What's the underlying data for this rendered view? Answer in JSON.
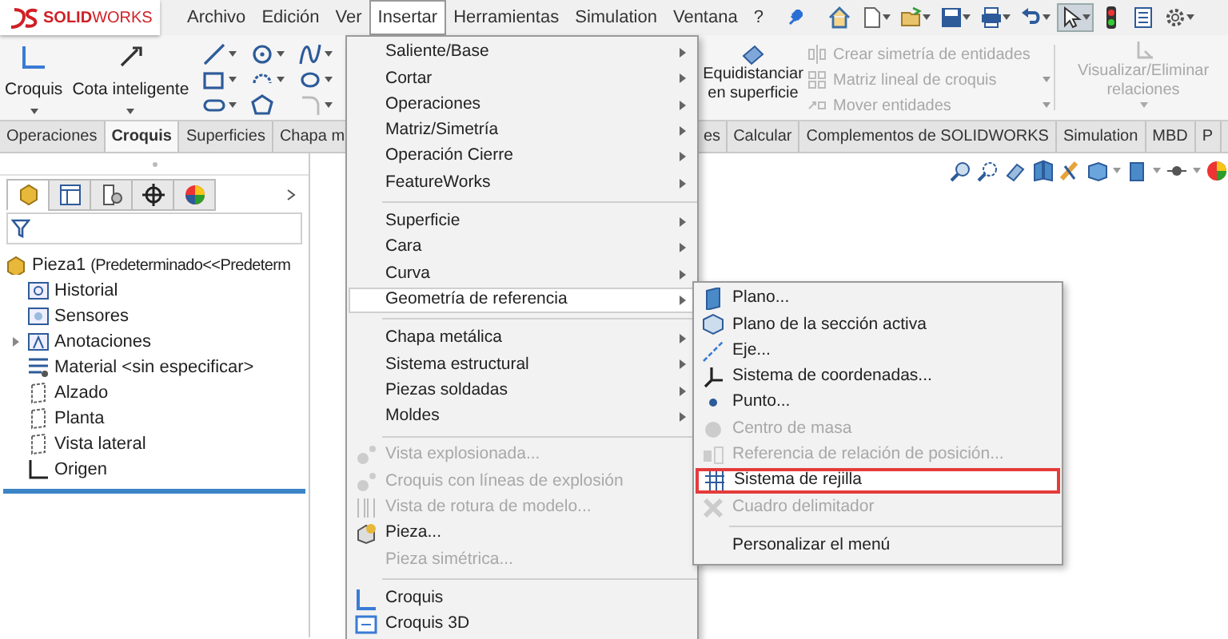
{
  "title_bar": {
    "logo_text": "**SOLID**WORKS"
  },
  "menu_bar": [
    {
      "label": "Archivo",
      "selected": false
    },
    {
      "label": "Edición",
      "selected": false
    },
    {
      "label": "Ver",
      "selected": false
    },
    {
      "label": "Insertar",
      "selected": true
    },
    {
      "label": "Herramientas",
      "selected": false
    },
    {
      "label": "Simulation",
      "selected": false
    },
    {
      "label": "Ventana",
      "selected": false
    },
    {
      "label": "?",
      "selected": false
    }
  ],
  "quick_access": {
    "select_tool": {
      "selected": true
    }
  },
  "ribbon": {
    "big_tools": [
      {
        "label": "Croquis"
      },
      {
        "label": "Cota inteligente"
      }
    ],
    "offset_tool": {
      "lines": [
        "Equidistanciar",
        "en superficie"
      ]
    },
    "commands": [
      {
        "label": "Crear simetría de entidades",
        "disabled": true,
        "dropdown": false
      },
      {
        "label": "Matriz lineal de croquis",
        "disabled": true,
        "dropdown": true
      },
      {
        "label": "Mover entidades",
        "disabled": true,
        "dropdown": true
      }
    ],
    "relations_tool": {
      "label": "Visualizar/Eliminar relaciones",
      "disabled": true
    }
  },
  "tabs": [
    {
      "label": "Operaciones",
      "selected": false
    },
    {
      "label": "Croquis",
      "selected": true
    },
    {
      "label": "Superficies",
      "selected": false
    },
    {
      "label": "Chapa m",
      "selected": false
    },
    {
      "label": "es",
      "selected": false
    },
    {
      "label": "Calcular",
      "selected": false
    },
    {
      "label": "Complementos de SOLIDWORKS",
      "selected": false
    },
    {
      "label": "Simulation",
      "selected": false
    },
    {
      "label": "MBD",
      "selected": false
    },
    {
      "label": "P",
      "selected": false
    }
  ],
  "feature_tree": {
    "panel_tabs": [
      {
        "selected": true
      },
      {
        "selected": false
      },
      {
        "selected": false
      },
      {
        "selected": false
      },
      {
        "selected": false
      }
    ],
    "root": {
      "label": "Pieza1",
      "detail": "(Predeterminado<<Predeterm",
      "children": [
        {
          "label": "Historial"
        },
        {
          "label": "Sensores"
        },
        {
          "label": "Anotaciones",
          "expanded": false
        },
        {
          "label": "Material <sin especificar>"
        },
        {
          "label": "Alzado"
        },
        {
          "label": "Planta"
        },
        {
          "label": "Vista lateral"
        },
        {
          "label": "Origen"
        }
      ]
    }
  },
  "insert_menu": {
    "groups": [
      [
        {
          "label": "Saliente/Base",
          "submenu": true,
          "disabled": false,
          "selected": false
        },
        {
          "label": "Cortar",
          "submenu": true,
          "disabled": false,
          "selected": false
        },
        {
          "label": "Operaciones",
          "submenu": true,
          "disabled": false,
          "selected": false
        },
        {
          "label": "Matriz/Simetría",
          "submenu": true,
          "disabled": false,
          "selected": false
        },
        {
          "label": "Operación Cierre",
          "submenu": true,
          "disabled": false,
          "selected": false
        },
        {
          "label": "FeatureWorks",
          "submenu": true,
          "disabled": false,
          "selected": false
        }
      ],
      [
        {
          "label": "Superficie",
          "submenu": true,
          "disabled": false,
          "selected": false
        },
        {
          "label": "Cara",
          "submenu": true,
          "disabled": false,
          "selected": false
        },
        {
          "label": "Curva",
          "submenu": true,
          "disabled": false,
          "selected": false
        },
        {
          "label": "Geometría de referencia",
          "submenu": true,
          "disabled": false,
          "selected": true
        }
      ],
      [
        {
          "label": "Chapa metálica",
          "submenu": true,
          "disabled": false,
          "selected": false
        },
        {
          "label": "Sistema estructural",
          "submenu": true,
          "disabled": false,
          "selected": false
        },
        {
          "label": "Piezas soldadas",
          "submenu": true,
          "disabled": false,
          "selected": false
        },
        {
          "label": "Moldes",
          "submenu": true,
          "disabled": false,
          "selected": false
        }
      ],
      [
        {
          "label": "Vista explosionada...",
          "submenu": false,
          "disabled": true,
          "selected": false
        },
        {
          "label": "Croquis con líneas de explosión",
          "submenu": false,
          "disabled": true,
          "selected": false
        },
        {
          "label": "Vista de rotura de modelo...",
          "submenu": false,
          "disabled": true,
          "selected": false
        },
        {
          "label": "Pieza...",
          "submenu": false,
          "disabled": false,
          "selected": false
        },
        {
          "label": "Pieza simétrica...",
          "submenu": false,
          "disabled": true,
          "selected": false
        }
      ],
      [
        {
          "label": "Croquis",
          "submenu": false,
          "disabled": false,
          "selected": false
        },
        {
          "label": "Croquis 3D",
          "submenu": false,
          "disabled": false,
          "selected": false
        }
      ]
    ]
  },
  "reference_submenu": {
    "groups": [
      [
        {
          "label": "Plano...",
          "disabled": false,
          "highlighted": false
        },
        {
          "label": "Plano de la sección activa",
          "disabled": false,
          "highlighted": false
        },
        {
          "label": "Eje...",
          "disabled": false,
          "highlighted": false
        },
        {
          "label": "Sistema de coordenadas...",
          "disabled": false,
          "highlighted": false
        },
        {
          "label": "Punto...",
          "disabled": false,
          "highlighted": false
        },
        {
          "label": "Centro de masa",
          "disabled": true,
          "highlighted": false
        },
        {
          "label": "Referencia de relación de posición...",
          "disabled": true,
          "highlighted": false
        },
        {
          "label": "Sistema de rejilla",
          "disabled": false,
          "highlighted": true
        },
        {
          "label": "Cuadro delimitador",
          "disabled": true,
          "highlighted": false
        }
      ],
      [
        {
          "label": "Personalizar el menú",
          "disabled": false,
          "highlighted": false
        }
      ]
    ]
  }
}
